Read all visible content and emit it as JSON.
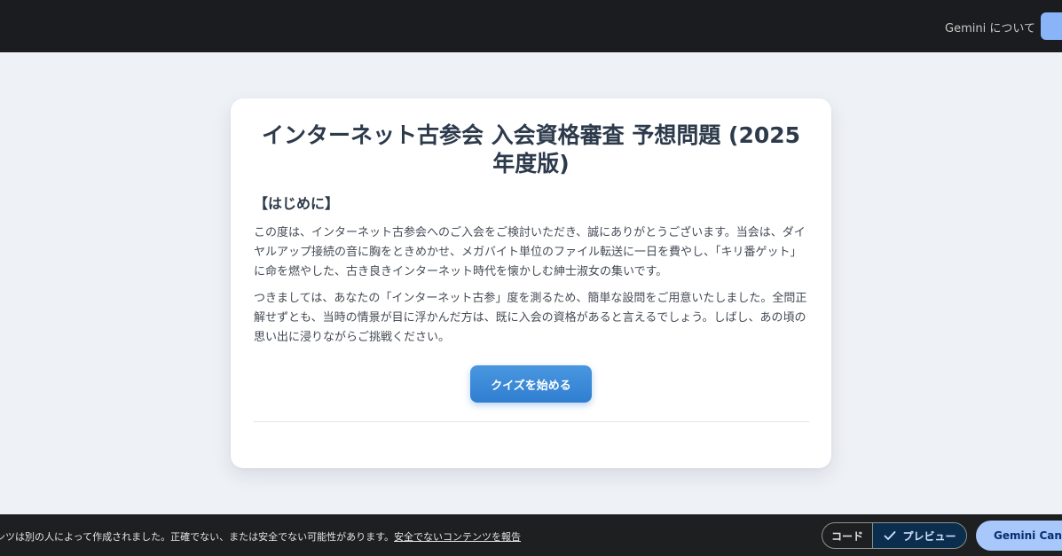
{
  "topbar": {
    "about_link": "Gemini について"
  },
  "card": {
    "title": "インターネット古参会 入会資格審査 予想問題 (2025年度版)",
    "section_heading": "【はじめに】",
    "paragraph_1": "この度は、インターネット古参会へのご入会をご検討いただき、誠にありがとうございます。当会は、ダイヤルアップ接続の音に胸をときめかせ、メガバイト単位のファイル転送に一日を費やし、「キリ番ゲット」に命を燃やした、古き良きインターネット時代を懐かしむ紳士淑女の集いです。",
    "paragraph_2": "つきましては、あなたの「インターネット古参」度を測るため、簡単な設問をご用意いたしました。全問正解せずとも、当時の情景が目に浮かんだ方は、既に入会の資格があると言えるでしょう。しばし、あの頃の思い出に浸りながらご挑戦ください。",
    "start_button": "クイズを始める"
  },
  "bottombar": {
    "disclaimer": "テンツは別の人によって作成されました。正確でない、または安全でない可能性があります。",
    "report_link": "安全でないコンテンツを報告",
    "toggle_code": "コード",
    "toggle_preview": "プレビュー",
    "canvas_button": "Gemini Canvas"
  },
  "colors": {
    "topbar": "#1b1c1f",
    "page_background": "#eef1f6",
    "primary_button": "#3a8ad6",
    "canvas_button": "#a8c7fa",
    "preview_toggle_active": "#0b2e4f"
  },
  "icons": {
    "preview_check": "check-icon"
  }
}
